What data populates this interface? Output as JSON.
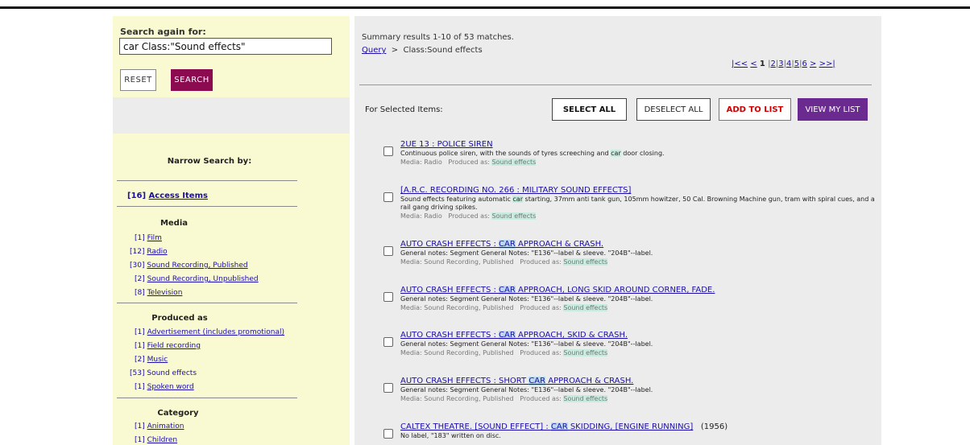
{
  "search": {
    "label": "Search again for:",
    "value": "car Class:\"Sound effects\"",
    "reset_label": "RESET",
    "search_label": "SEARCH"
  },
  "narrow": {
    "title": "Narrow Search by:",
    "access_count": "[16]",
    "access_label": "Access Items",
    "media_title": "Media",
    "media": [
      {
        "count": "[1]",
        "label": "Film"
      },
      {
        "count": "[12]",
        "label": "Radio"
      },
      {
        "count": "[30]",
        "label": "Sound Recording, Published"
      },
      {
        "count": "[2]",
        "label": "Sound Recording, Unpublished"
      },
      {
        "count": "[8]",
        "label": "Television"
      }
    ],
    "produced_title": "Produced as",
    "produced": [
      {
        "count": "[1]",
        "label": "Advertisement (includes promotional)"
      },
      {
        "count": "[1]",
        "label": "Field recording"
      },
      {
        "count": "[2]",
        "label": "Music"
      },
      {
        "count": "[53]",
        "label": "Sound effects"
      },
      {
        "count": "[1]",
        "label": "Spoken word"
      }
    ],
    "category_title": "Category",
    "category": [
      {
        "count": "[1]",
        "label": "Animation"
      },
      {
        "count": "[1]",
        "label": "Children"
      }
    ]
  },
  "main": {
    "summary": "Summary results 1-10 of 53 matches.",
    "crumb_query": "Query",
    "crumb_sep": ">",
    "crumb_current": "Class:Sound effects",
    "pager": {
      "first": "|<<",
      "prev": "<",
      "current": "1",
      "pages": [
        "2",
        "3",
        "4",
        "5",
        "6"
      ],
      "next": ">",
      "last": ">>|"
    },
    "selected_label": "For Selected Items:",
    "select_all": "SELECT ALL",
    "deselect_all": "DESELECT ALL",
    "add_to_list": "ADD TO LIST",
    "view_my_list": "VIEW MY LIST"
  },
  "results": [
    {
      "title": "2UE 13 : POLICE SIREN",
      "desc_a": "Continuous police siren, with the sounds of tyres screeching and ",
      "desc_hl": "car",
      "desc_b": " door closing.",
      "media": "Media: Radio",
      "produced_label": "Produced as:",
      "produced_value": "Sound effects"
    },
    {
      "title": "[A.R.C. RECORDING NO. 266 : MILITARY SOUND EFFECTS]",
      "desc_a": "Sound effects featuring automatic ",
      "desc_hl": "car",
      "desc_b": " starting, 37mm anti tank gun, 105mm howitzer, 50 Cal. Browning Machine gun, tram with spiral cues, and a rail gang driving spikes.",
      "media": "Media: Radio",
      "produced_label": "Produced as:",
      "produced_value": "Sound effects"
    },
    {
      "title_a": "AUTO CRASH EFFECTS : ",
      "title_hl": "CAR",
      "title_b": " APPROACH & CRASH.",
      "desc": "General notes: Segment General Notes: \"E136\"--label & sleeve. \"204B\"--label.",
      "media": "Media: Sound Recording, Published",
      "produced_label": "Produced as:",
      "produced_value": "Sound effects"
    },
    {
      "title_a": "AUTO CRASH EFFECTS : ",
      "title_hl": "CAR",
      "title_b": " APPROACH, LONG SKID AROUND CORNER, FADE.",
      "desc": "General notes: Segment General Notes: \"E136\"--label & sleeve. \"204B\"--label.",
      "media": "Media: Sound Recording, Published",
      "produced_label": "Produced as:",
      "produced_value": "Sound effects"
    },
    {
      "title_a": "AUTO CRASH EFFECTS : ",
      "title_hl": "CAR",
      "title_b": " APPROACH, SKID & CRASH.",
      "desc": "General notes: Segment General Notes: \"E136\"--label & sleeve. \"204B\"--label.",
      "media": "Media: Sound Recording, Published",
      "produced_label": "Produced as:",
      "produced_value": "Sound effects"
    },
    {
      "title_a": "AUTO CRASH EFFECTS : SHORT ",
      "title_hl": "CAR",
      "title_b": " APPROACH & CRASH.",
      "desc": "General notes: Segment General Notes: \"E136\"--label & sleeve. \"204B\"--label.",
      "media": "Media: Sound Recording, Published",
      "produced_label": "Produced as:",
      "produced_value": "Sound effects"
    },
    {
      "title_a": "CALTEX THEATRE. [SOUND EFFECT] : ",
      "title_hl": "CAR",
      "title_b": " SKIDDING, [ENGINE RUNNING]",
      "year": "(1956)",
      "desc": "No label, \"183\" written on disc."
    }
  ],
  "colors": {
    "sidebar_bg": "#fafad2",
    "main_bg": "#ececec",
    "search_button": "#8b0a50",
    "view_list_button": "#6a2a90",
    "add_to_list_text": "#d00000",
    "highlight": "#c7ecdf"
  }
}
